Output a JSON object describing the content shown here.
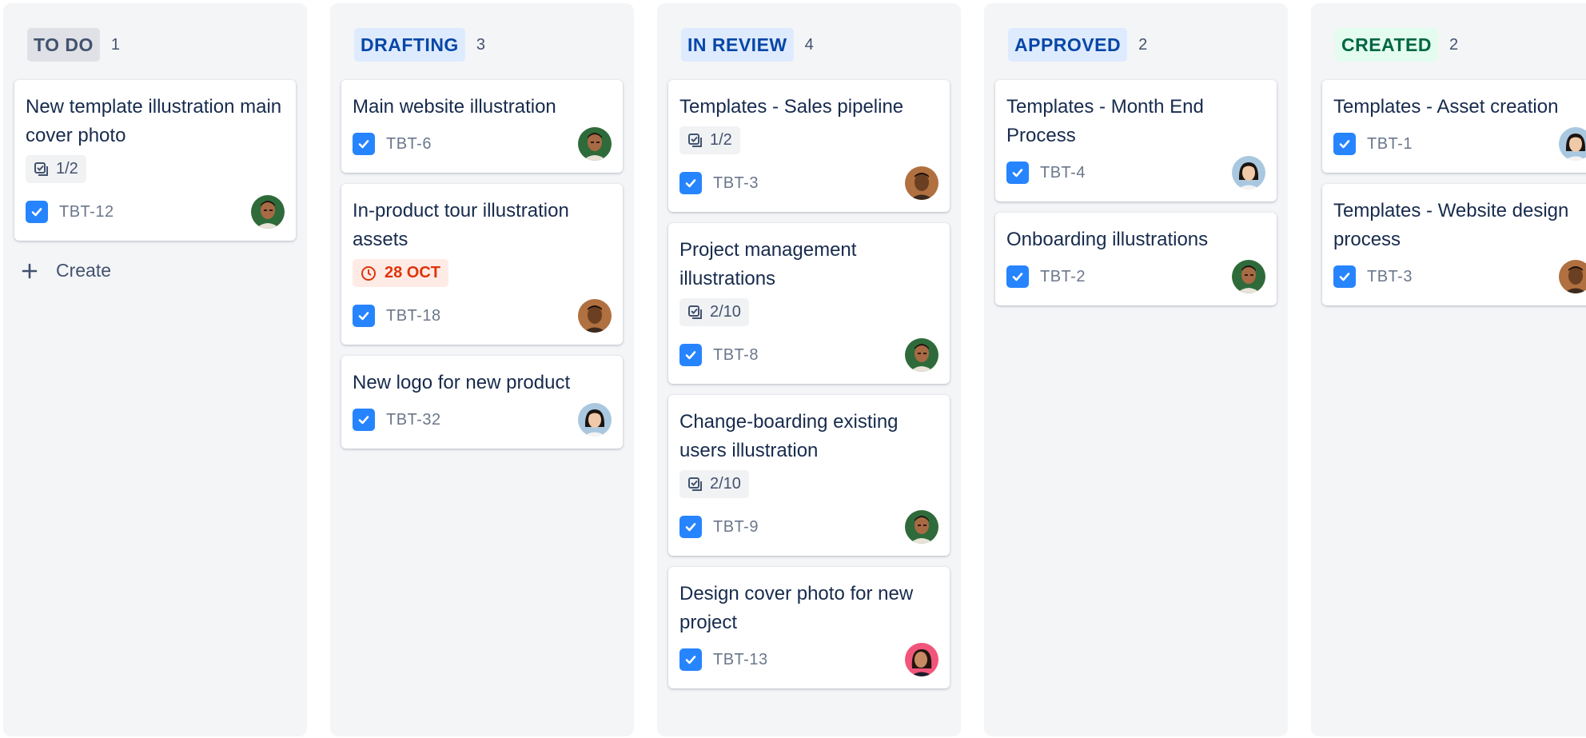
{
  "colors": {
    "todo_bg": "#dfe1e6",
    "todo_fg": "#42526e",
    "blue_bg": "#deebff",
    "blue_fg": "#0747a6",
    "green_bg": "#e3fcef",
    "green_fg": "#006644",
    "danger": "#de350b",
    "checkbox": "#2684ff"
  },
  "columns": [
    {
      "title": "TO DO",
      "count": "1",
      "cards": [
        {
          "title": "New template illustration main cover photo",
          "subtasks": "1/2",
          "key": "TBT-12",
          "avatar": "avatar-man-green"
        }
      ],
      "create_label": "Create"
    },
    {
      "title": "DRAFTING",
      "count": "3",
      "cards": [
        {
          "title": "Main website illustration",
          "key": "TBT-6",
          "avatar": "avatar-man-green"
        },
        {
          "title": "In-product tour illustration assets",
          "due": "28 OCT",
          "key": "TBT-18",
          "avatar": "avatar-man-brown"
        },
        {
          "title": "New logo for new product",
          "key": "TBT-32",
          "avatar": "avatar-woman-blue"
        }
      ]
    },
    {
      "title": "IN REVIEW",
      "count": "4",
      "cards": [
        {
          "title": "Templates - Sales pipeline",
          "subtasks": "1/2",
          "key": "TBT-3",
          "avatar": "avatar-man-brown"
        },
        {
          "title": "Project management illustrations",
          "subtasks": "2/10",
          "key": "TBT-8",
          "avatar": "avatar-man-green"
        },
        {
          "title": "Change-boarding existing users illustration",
          "subtasks": "2/10",
          "key": "TBT-9",
          "avatar": "avatar-man-green"
        },
        {
          "title": "Design cover photo for new project",
          "key": "TBT-13",
          "avatar": "avatar-woman-pink"
        }
      ]
    },
    {
      "title": "APPROVED",
      "count": "2",
      "cards": [
        {
          "title": "Templates - Month End Process",
          "key": "TBT-4",
          "avatar": "avatar-woman-blue"
        },
        {
          "title": "Onboarding illustrations",
          "key": "TBT-2",
          "avatar": "avatar-man-green"
        }
      ]
    },
    {
      "title": "CREATED",
      "count": "2",
      "cards": [
        {
          "title": "Templates - Asset creation",
          "key": "TBT-1",
          "avatar": "avatar-woman-blue"
        },
        {
          "title": "Templates - Website design process",
          "key": "TBT-3",
          "avatar": "avatar-man-brown"
        }
      ]
    }
  ]
}
